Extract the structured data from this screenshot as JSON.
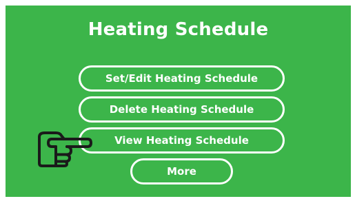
{
  "screen": {
    "background_color": "#3cb54a",
    "foreground_color": "#ffffff",
    "title": "Heating Schedule"
  },
  "menu": {
    "items": [
      {
        "label": "Set/Edit Heating Schedule"
      },
      {
        "label": "Delete Heating Schedule"
      },
      {
        "label": "View Heating Schedule",
        "selected": true
      },
      {
        "label": "More"
      }
    ]
  },
  "pointer": {
    "icon": "pointing-hand-icon",
    "selected_item_index": 2
  }
}
